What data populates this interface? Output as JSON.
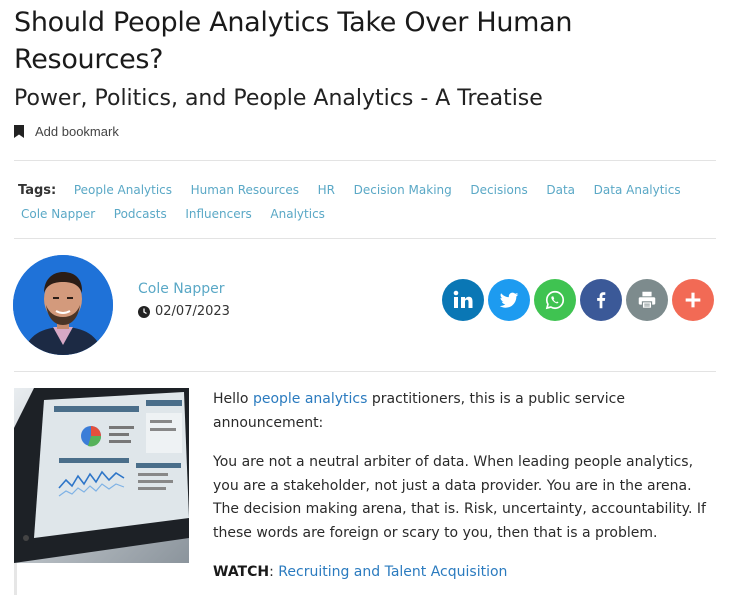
{
  "article": {
    "title": "Should People Analytics Take Over Human Resources?",
    "subtitle": "Power, Politics, and People Analytics - A Treatise",
    "bookmark_label": "Add bookmark"
  },
  "tags": {
    "label": "Tags:",
    "items": [
      "People Analytics",
      "Human Resources",
      "HR",
      "Decision Making",
      "Decisions",
      "Data",
      "Data Analytics",
      "Cole Napper",
      "Podcasts",
      "Influencers",
      "Analytics"
    ]
  },
  "author": {
    "name": "Cole Napper",
    "date": "02/07/2023"
  },
  "share": {
    "buttons": [
      {
        "icon": "linkedin-icon",
        "color": "#0a77b5"
      },
      {
        "icon": "twitter-icon",
        "color": "#1d9bf0"
      },
      {
        "icon": "whatsapp-icon",
        "color": "#3fc351"
      },
      {
        "icon": "facebook-icon",
        "color": "#3b5998"
      },
      {
        "icon": "print-icon",
        "color": "#7d8b8d"
      },
      {
        "icon": "plus-icon",
        "color": "#f26a55"
      }
    ]
  },
  "body": {
    "p1_before": "Hello ",
    "p1_link": "people analytics",
    "p1_after": " practitioners, this is a public service announcement:",
    "p2": "You are not a neutral arbiter of data. When leading people analytics, you are a stakeholder, not just a data provider. You are in the arena. The decision making arena, that is. Risk, uncertainty, accountability. If these words are foreign or scary to you, then that is a problem.",
    "watch_label": "WATCH",
    "watch_sep": ": ",
    "watch_link": "Recruiting and Talent Acquisition"
  }
}
